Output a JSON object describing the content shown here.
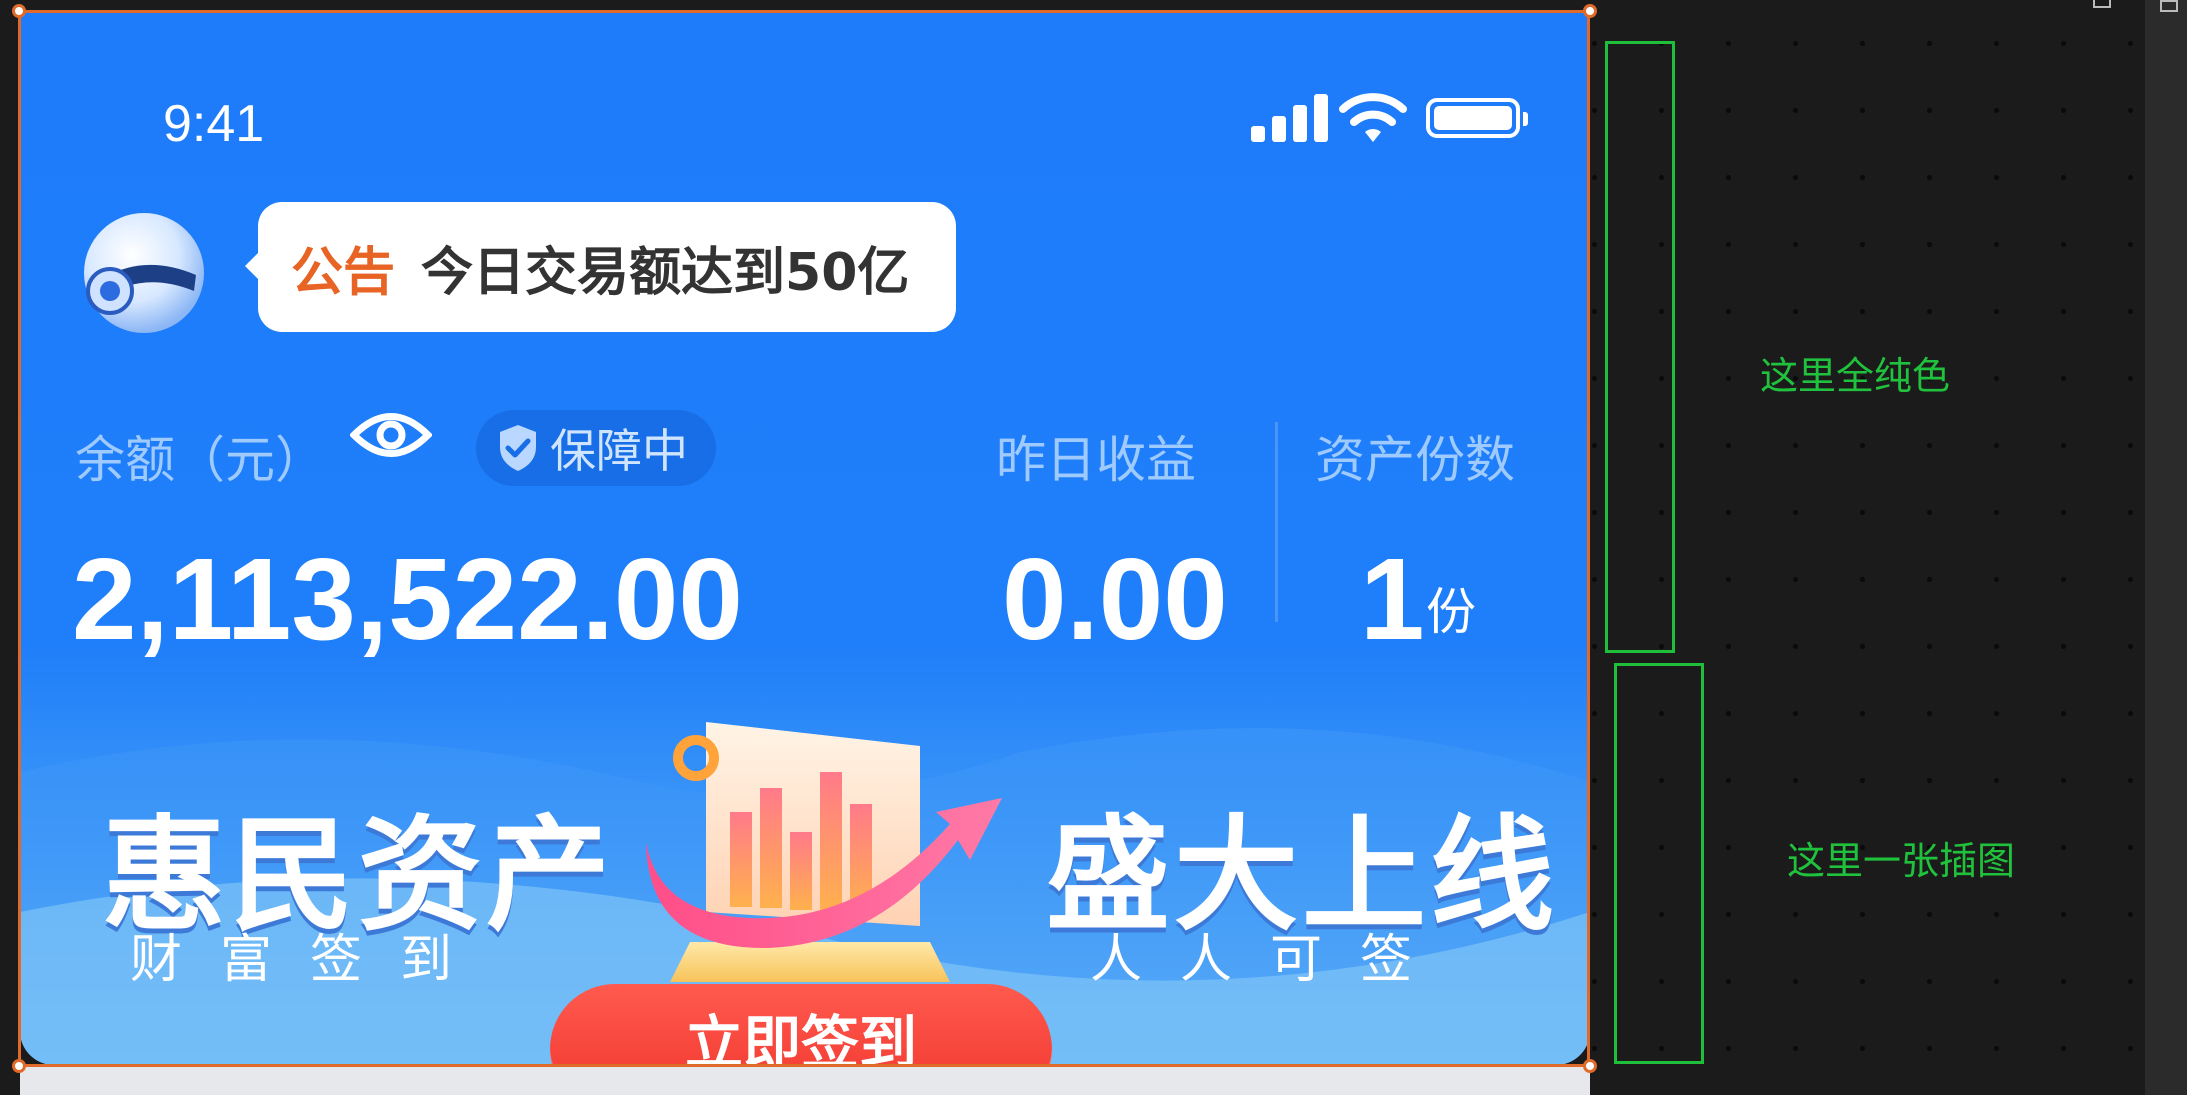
{
  "status_bar": {
    "time": "9:41"
  },
  "announcement": {
    "tag": "公告",
    "text": "今日交易额达到50亿"
  },
  "balance": {
    "label": "余额（元）",
    "guard_label": "保障中",
    "amount": "2,113,522.00"
  },
  "yesterday": {
    "label": "昨日收益",
    "value": "0.00"
  },
  "assets": {
    "label": "资产份数",
    "value": "1",
    "unit": "份"
  },
  "banner": {
    "left_title": "惠民资产",
    "left_sub": "财富签到",
    "right_title": "盛大上线",
    "right_sub": "人人可签",
    "cta_label": "立即签到"
  },
  "annotations": {
    "solid_color_note": "这里全纯色",
    "illustration_note": "这里一张插图"
  },
  "colors": {
    "brand_blue": "#1e7cfb",
    "accent_orange": "#e86424",
    "cta_red": "#f0332c",
    "annotation_green": "#1fbf3b",
    "selection_orange": "#e06a2a"
  },
  "icons": [
    "mascot-robot-icon",
    "signal-icon",
    "wifi-icon",
    "battery-icon",
    "eye-icon",
    "shield-check-icon",
    "chart-arrow-illustration"
  ]
}
